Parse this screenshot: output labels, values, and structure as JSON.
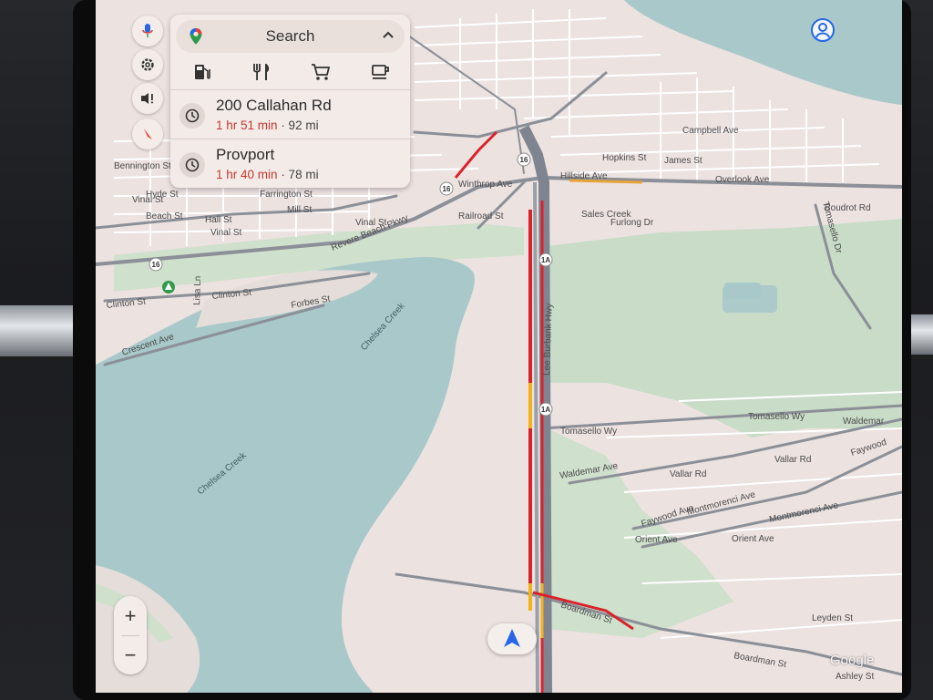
{
  "colors": {
    "land": "#ece2e0",
    "water": "#a9c8c9",
    "park": "#c9dcc8",
    "road": "#8b8f97",
    "minor_road": "#ffffff",
    "traffic_red": "#d9232c",
    "traffic_yellow": "#f2b21b",
    "eta": "#c5392e",
    "nav_arrow": "#2767e6"
  },
  "search": {
    "label": "Search",
    "categories": [
      "gas-station-icon",
      "restaurant-icon",
      "shopping-cart-icon",
      "coffee-icon"
    ]
  },
  "destinations": [
    {
      "name": "200 Callahan Rd",
      "eta": "1 hr 51 min",
      "distance": "· 92 mi"
    },
    {
      "name": "Provport",
      "eta": "1 hr 40 min",
      "distance": "· 78 mi"
    }
  ],
  "rail": [
    "microphone-icon",
    "gear-icon",
    "sound-alert-icon",
    "compass-icon"
  ],
  "zoom": {
    "in": "+",
    "out": "−"
  },
  "attribution": "Google",
  "map_labels": {
    "lee_burbank_hwy": "Lee Burbank Hwy",
    "revere_beach_pkwy": "Revere Beach Pkwy",
    "chelsea_creek_1": "Chelsea Creek",
    "chelsea_creek_2": "Chelsea Creek",
    "tomasello_wy_1": "Tomasello Wy",
    "tomasello_wy_2": "Tomasello Wy",
    "waldemar_ave_1": "Waldemar Ave",
    "waldemar_ave_2": "Waldemar",
    "vallar_rd_1": "Vallar Rd",
    "vallar_rd_2": "Vallar Rd",
    "faywood_ave_1": "Faywood Ave",
    "faywood_ave_2": "Faywood",
    "montmorenci_ave_1": "Montmorenci Ave",
    "montmorenci_ave_2": "Montmorenci Ave",
    "orient_ave_1": "Orient Ave",
    "orient_ave_2": "Orient Ave",
    "boardman_st_1": "Boardman St",
    "boardman_st_2": "Boardman St",
    "leyden_st": "Leyden St",
    "ashley_st": "Ashley St",
    "clinton_st_1": "Clinton St",
    "clinton_st_2": "Clinton St",
    "forbes_st": "Forbes St",
    "crescent_ave": "Crescent Ave",
    "lisa_ln": "Lisa Ln",
    "railroad_st": "Railroad St",
    "furlong_dr": "Furlong Dr",
    "sales_creek": "Sales Creek",
    "winthrop_ave": "Winthrop Ave",
    "overlook_ave": "Overlook Ave",
    "boudrot_rd": "Boudrot Rd",
    "tomasello_dr": "Tomasello Dr",
    "bennington_st": "Bennington St",
    "hyde_st": "Hyde St",
    "beach_st": "Beach St",
    "hall_st": "Hall St",
    "vinal_st_1": "Vinal St",
    "vinal_st_2": "Vinal St",
    "vinal_st_3": "Vinal St",
    "mill_st": "Mill St",
    "farrington_st": "Farrington St",
    "hopkins_st": "Hopkins St",
    "james_st": "James St",
    "hillside_ave": "Hillside Ave",
    "campbell_ave": "Campbell Ave"
  },
  "shields": {
    "route_1a_a": "1A",
    "route_1a_b": "1A",
    "route_16_a": "16",
    "route_16_b": "16",
    "route_16_c": "16"
  }
}
